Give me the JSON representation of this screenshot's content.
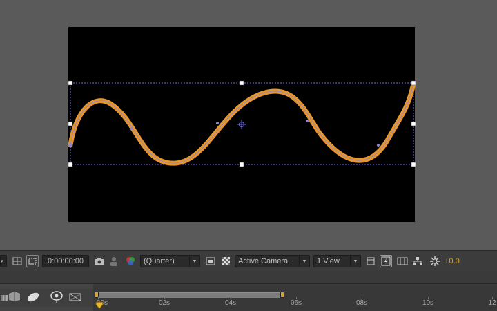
{
  "toolbar": {
    "timecode": "0:00:00:00",
    "resolution": "(Quarter)",
    "camera": "Active Camera",
    "views": "1 View",
    "exposure": "+0.0",
    "icons": [
      "magnification-icon",
      "grid-icon",
      "region-of-interest-icon",
      "snapshot-icon",
      "show-snapshot-icon",
      "color-channel-icon",
      "toggle-mask-icon",
      "transparency-grid-icon",
      "pixel-aspect-icon",
      "fast-preview-icon",
      "timeline-icon",
      "flowchart-icon",
      "reset-exposure-icon"
    ]
  },
  "timeline": {
    "ticks": [
      "00s",
      "02s",
      "04s",
      "06s",
      "08s",
      "10s",
      "12"
    ]
  },
  "colors": {
    "stroke": "#e8962a",
    "path": "#9a8fd8",
    "accent": "#d3a233",
    "comp_bg": "#000000"
  }
}
